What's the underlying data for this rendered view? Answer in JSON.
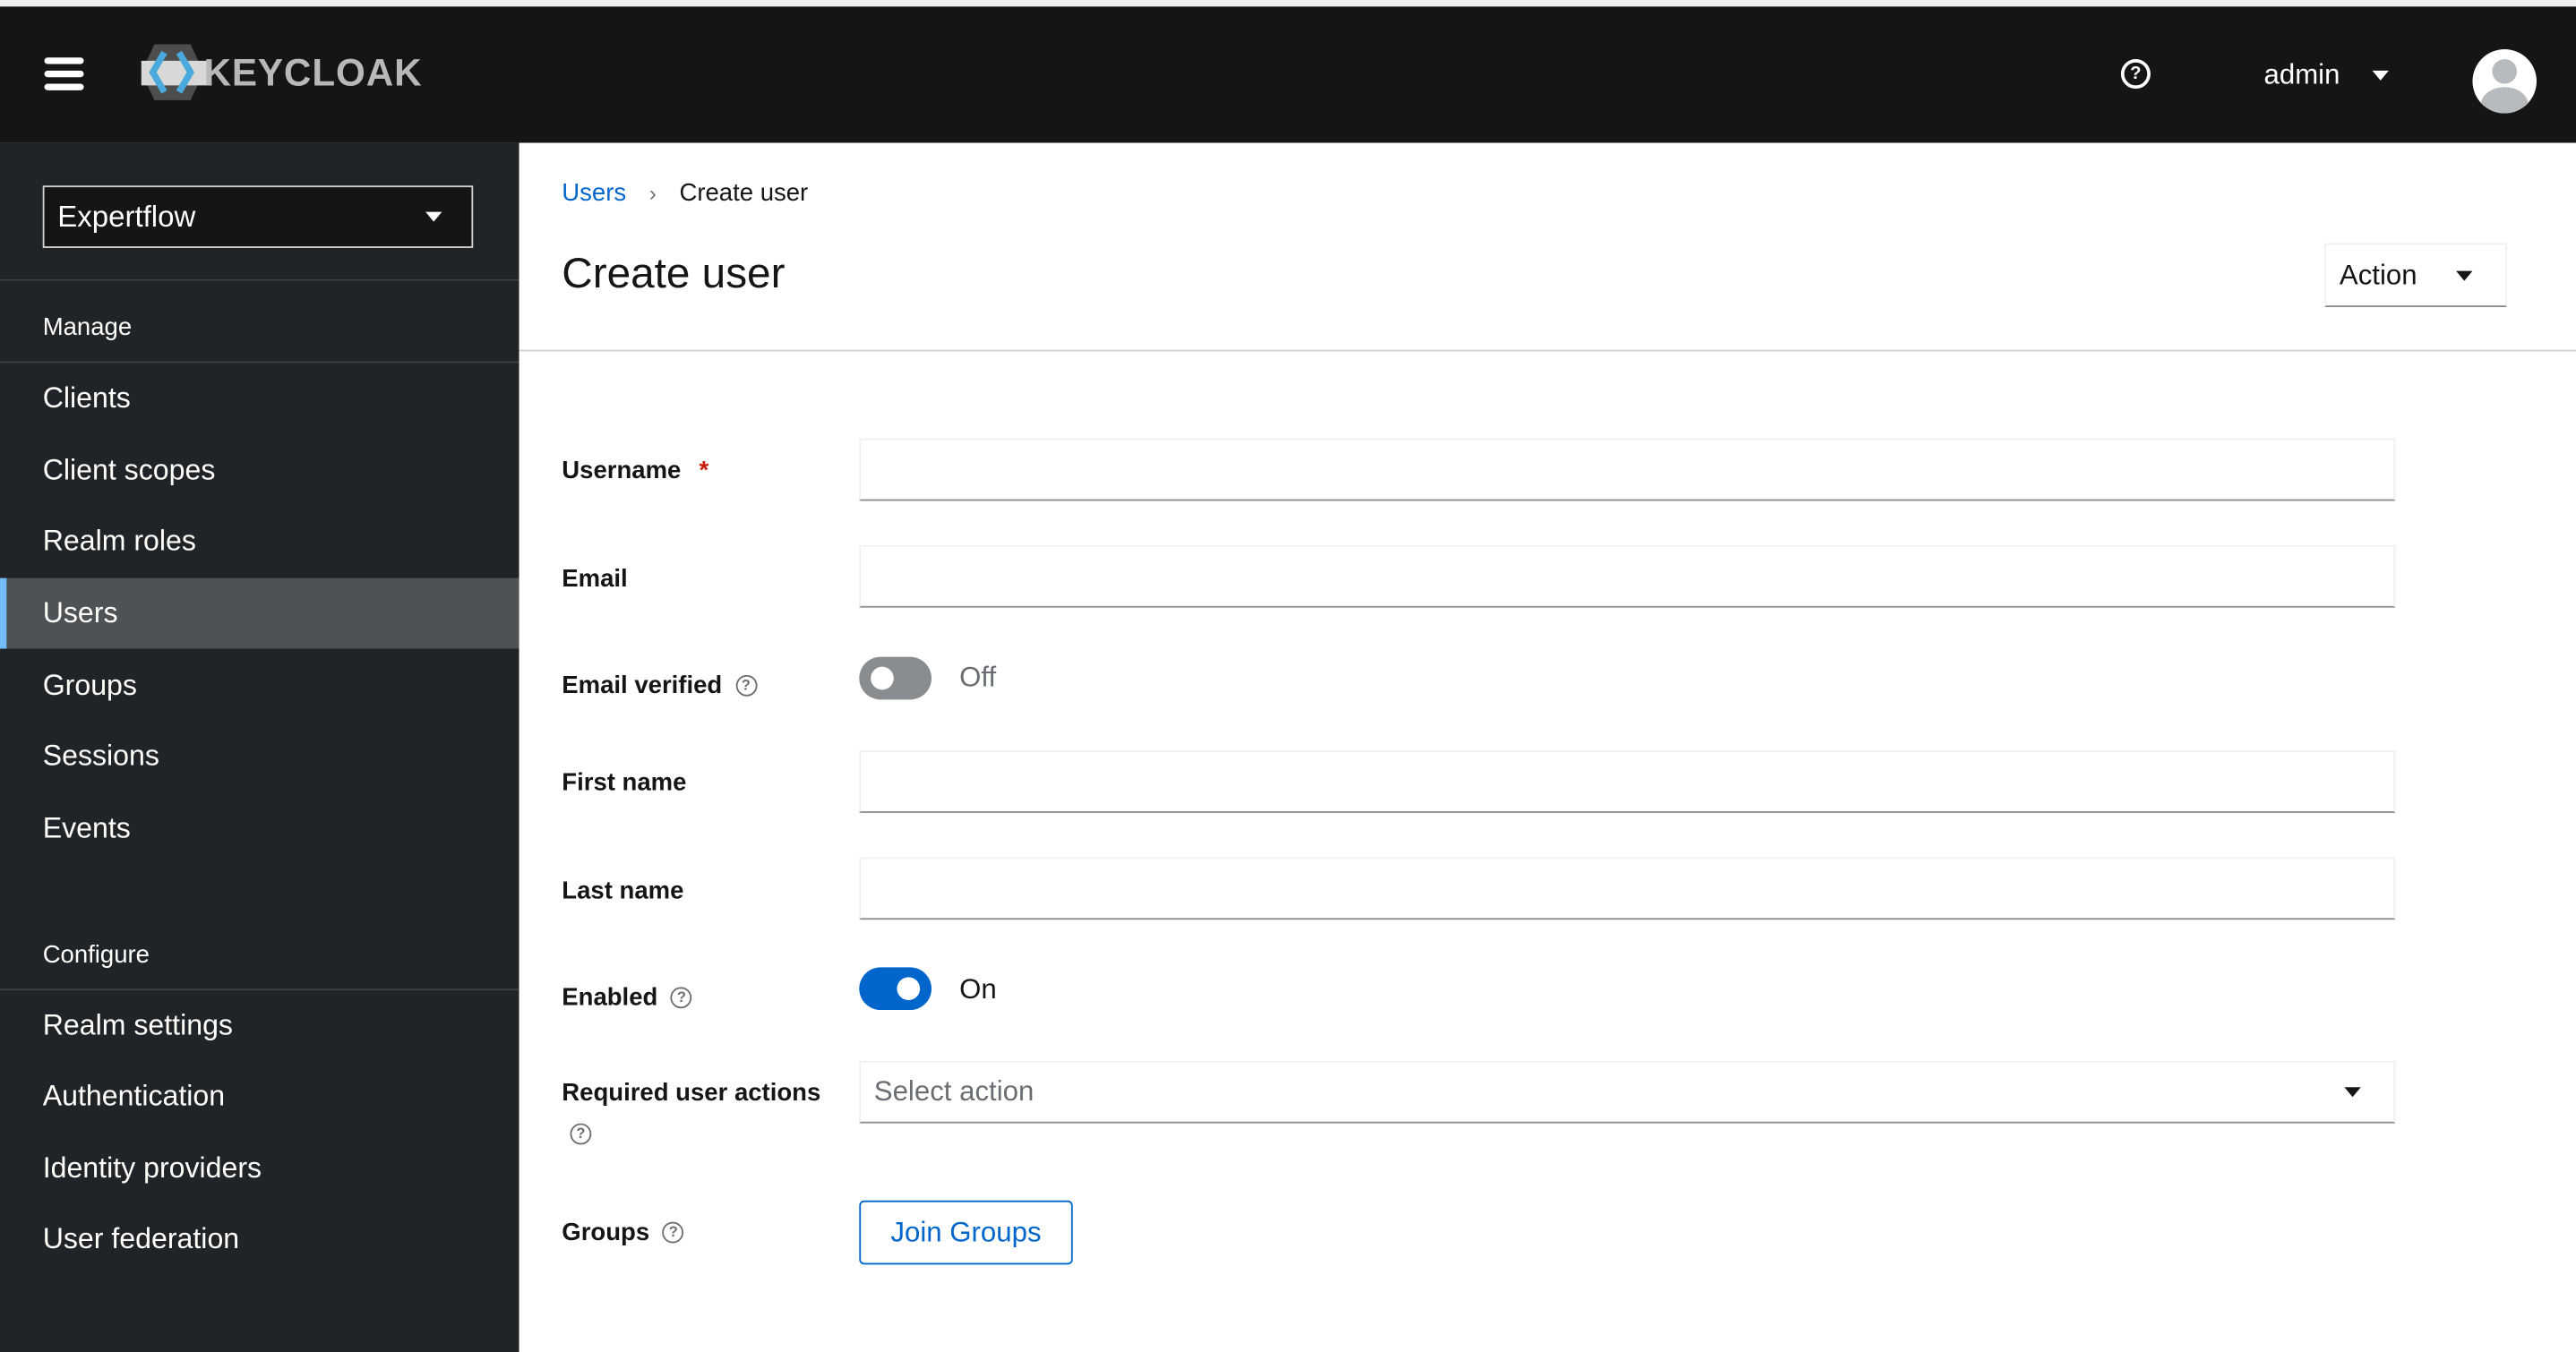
{
  "header": {
    "logo_text": "KEYCLOAK",
    "user": "admin"
  },
  "sidebar": {
    "realm": "Expertflow",
    "manage_label": "Manage",
    "manage_items": [
      "Clients",
      "Client scopes",
      "Realm roles",
      "Users",
      "Groups",
      "Sessions",
      "Events"
    ],
    "active_item": "Users",
    "configure_label": "Configure",
    "configure_items": [
      "Realm settings",
      "Authentication",
      "Identity providers",
      "User federation"
    ]
  },
  "main": {
    "breadcrumb": {
      "parent": "Users",
      "current": "Create user"
    },
    "title": "Create user",
    "action_label": "Action",
    "form": {
      "username_label": "Username",
      "required_mark": "*",
      "username_value": "",
      "email_label": "Email",
      "email_value": "",
      "email_verified_label": "Email verified",
      "email_verified_state": "Off",
      "first_name_label": "First name",
      "first_name_value": "",
      "last_name_label": "Last name",
      "last_name_value": "",
      "enabled_label": "Enabled",
      "enabled_state": "On",
      "required_actions_label": "Required user actions",
      "required_actions_placeholder": "Select action",
      "groups_label": "Groups",
      "join_groups_label": "Join Groups"
    },
    "colors": {
      "accent": "#0066cc",
      "toggle_on": "#0066cc",
      "toggle_off": "#8a8d90"
    }
  }
}
